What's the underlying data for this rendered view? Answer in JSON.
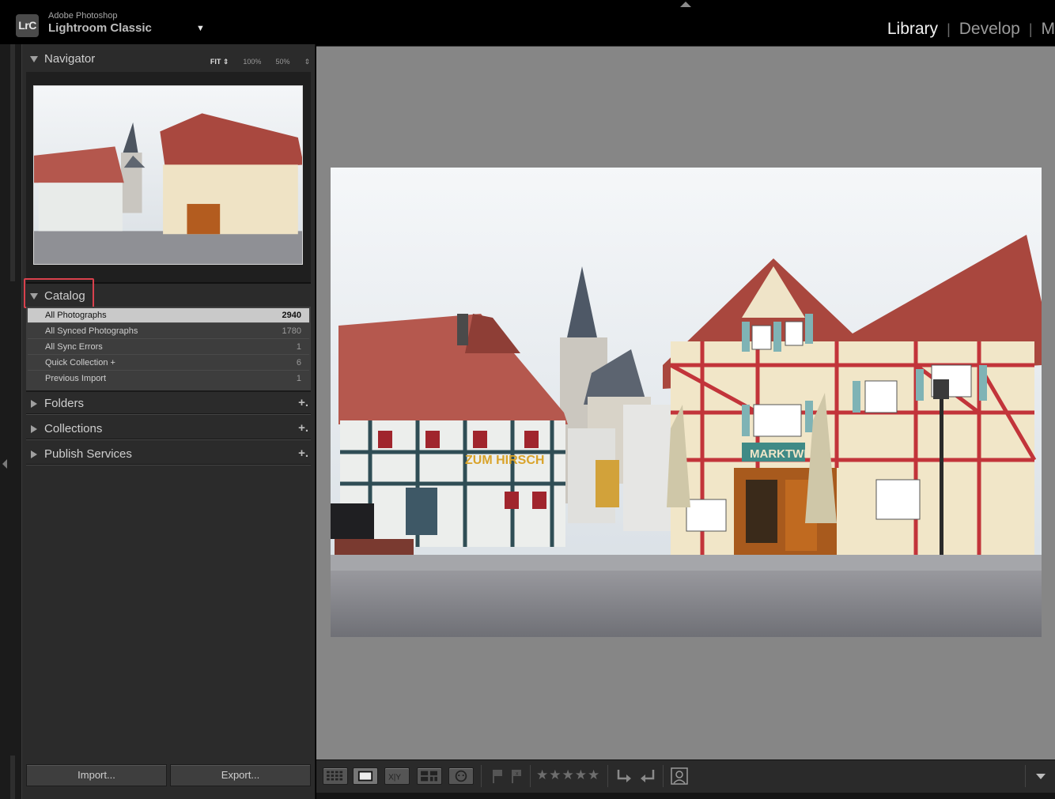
{
  "app": {
    "logo": "LrC",
    "vendor": "Adobe Photoshop",
    "name": "Lightroom Classic",
    "identity_menu": "▼"
  },
  "modules": [
    {
      "label": "Library",
      "active": true
    },
    {
      "label": "Develop",
      "active": false
    },
    {
      "label": "M",
      "active": false
    }
  ],
  "navigator": {
    "title": "Navigator",
    "zoom_options": [
      "FIT ⇕",
      "100%",
      "50%",
      "⇕"
    ]
  },
  "catalog": {
    "title": "Catalog",
    "items": [
      {
        "label": "All Photographs",
        "count": "2940",
        "selected": true
      },
      {
        "label": "All Synced Photographs",
        "count": "1780",
        "selected": false
      },
      {
        "label": "All Sync Errors",
        "count": "1",
        "selected": false
      },
      {
        "label": "Quick Collection  +",
        "count": "6",
        "selected": false
      },
      {
        "label": "Previous Import",
        "count": "1",
        "selected": false
      }
    ]
  },
  "panels": [
    {
      "title": "Folders",
      "add": "+."
    },
    {
      "title": "Collections",
      "add": "+."
    },
    {
      "title": "Publish Services",
      "add": "+."
    }
  ],
  "buttons": {
    "import": "Import...",
    "export": "Export..."
  },
  "toolbar": {
    "compare_label": "X|Y",
    "stars": "★★★★★"
  },
  "colors": {
    "highlight_border": "#d9414d",
    "canvas_bg": "#868686",
    "panel_bg": "#2b2b2b"
  }
}
